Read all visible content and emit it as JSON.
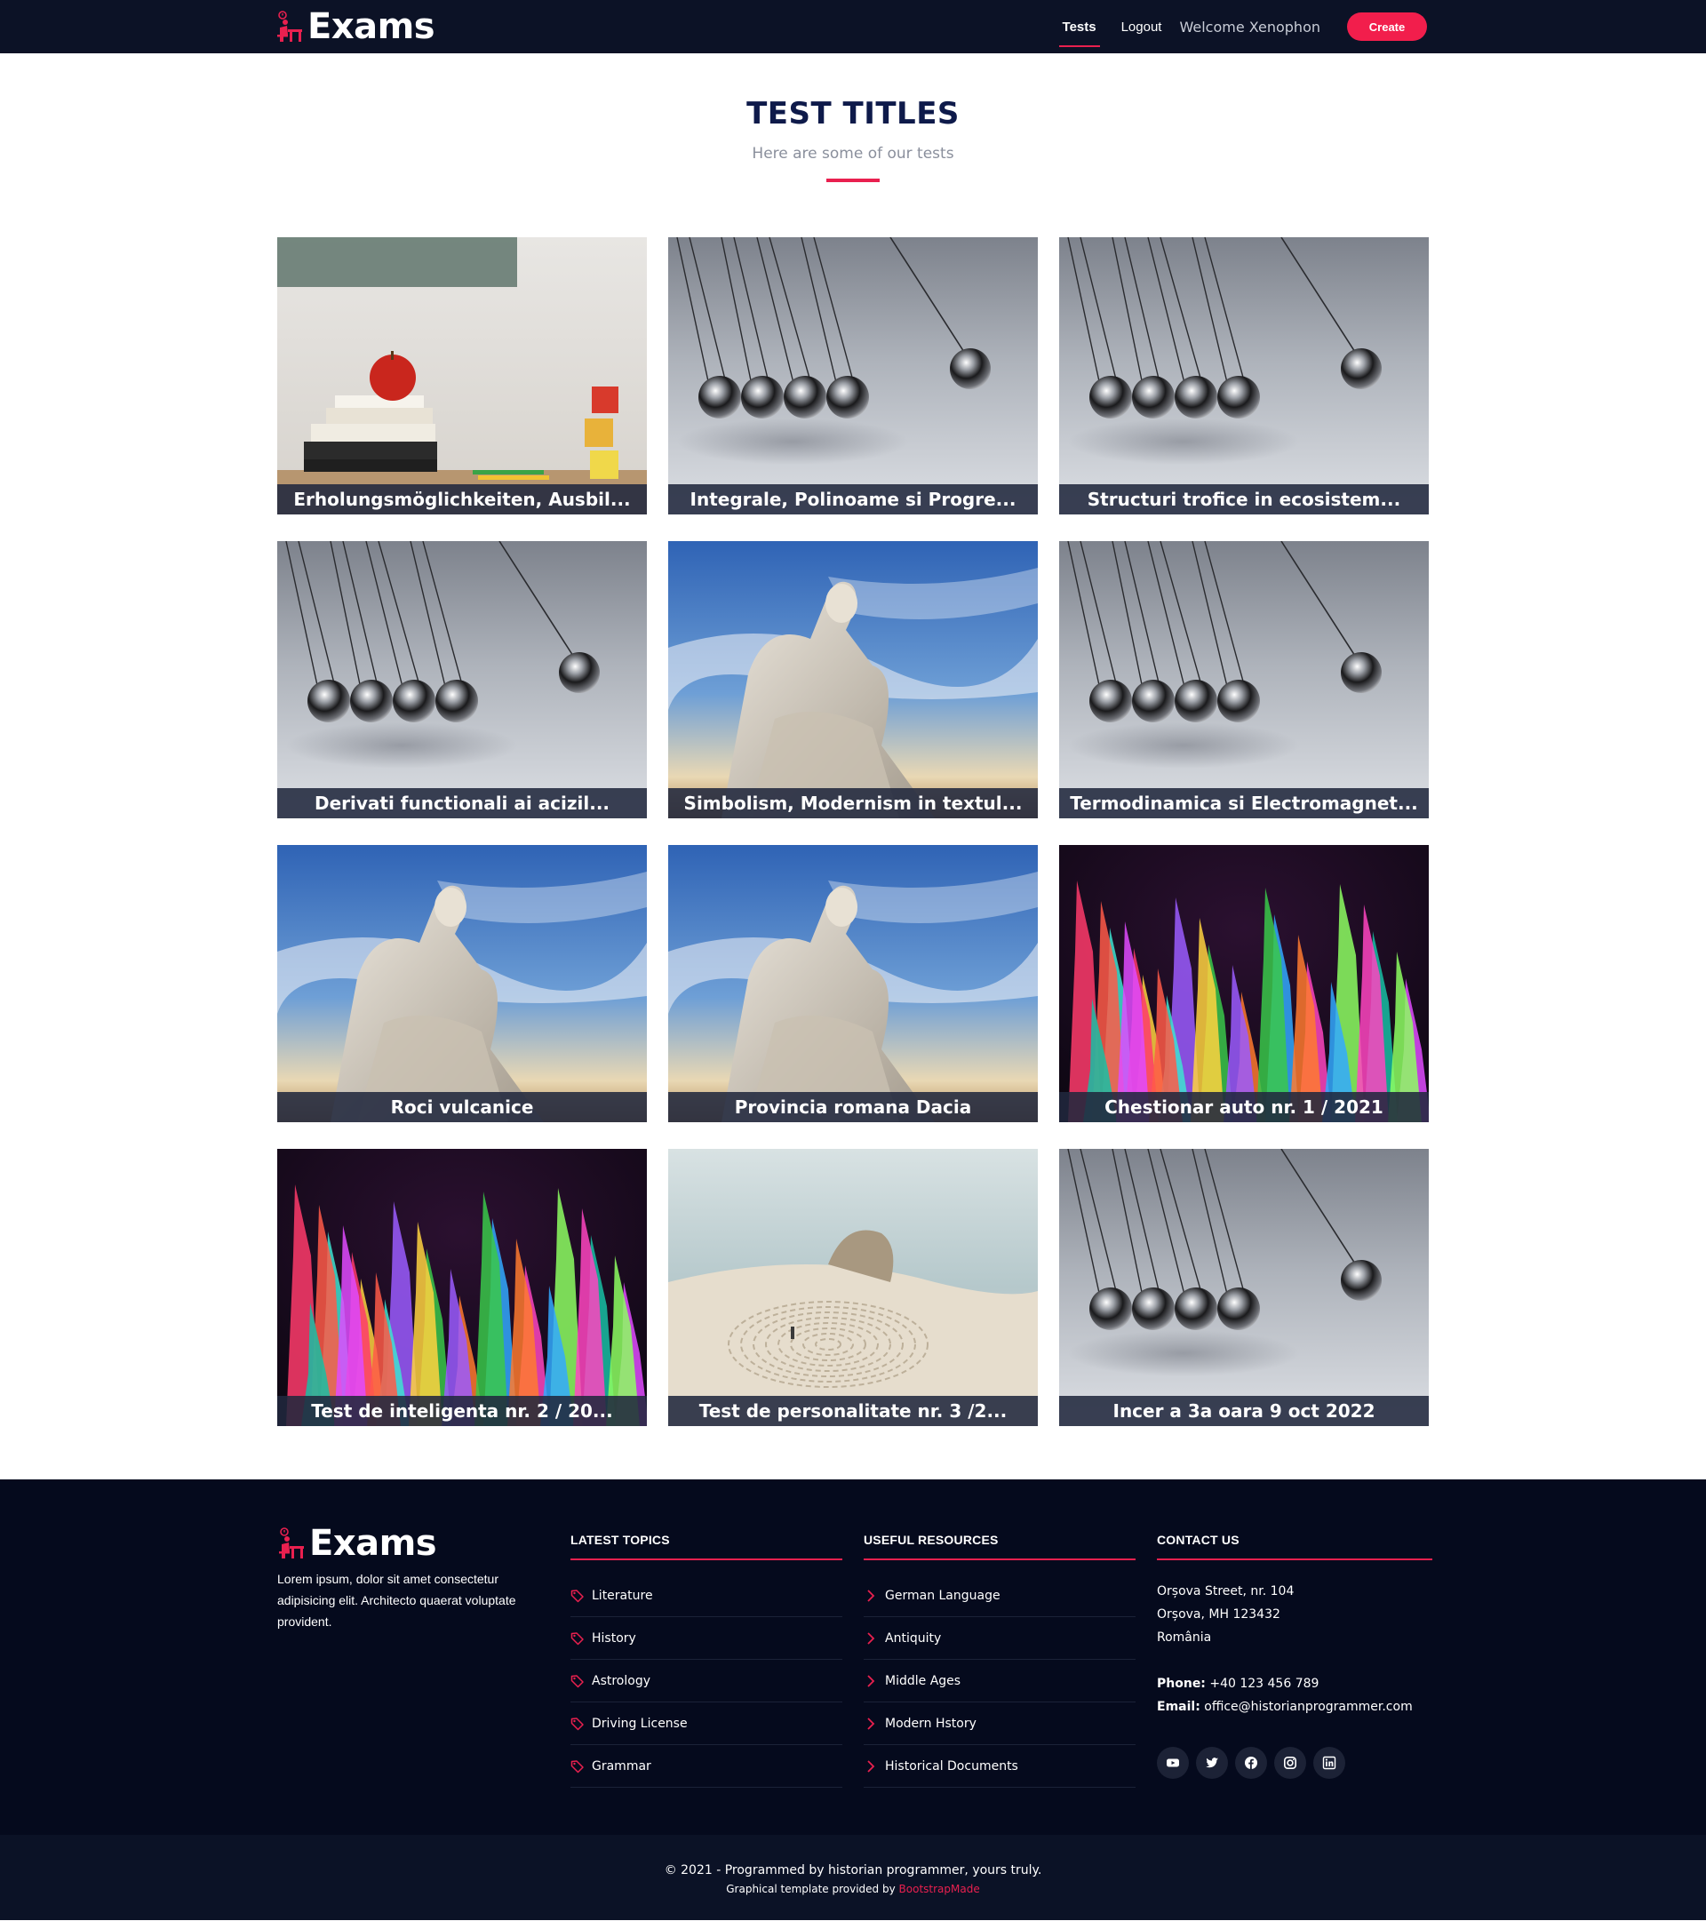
{
  "header": {
    "brand": "Exams",
    "nav": {
      "tests": "Tests",
      "logout": "Logout",
      "welcome": "Welcome Xenophon",
      "create": "Create"
    }
  },
  "section": {
    "title": "TEST TITLES",
    "subtitle": "Here are some of our tests"
  },
  "cards": [
    {
      "title": "Erholungsmöglichkeiten, Ausbil...",
      "image": "apple-books-blocks"
    },
    {
      "title": "Integrale, Polinoame si Progre...",
      "image": "newtons-cradle"
    },
    {
      "title": "Structuri trofice in ecosistem...",
      "image": "newtons-cradle"
    },
    {
      "title": "Derivati functionali ai acizil...",
      "image": "newtons-cradle"
    },
    {
      "title": "Simbolism, Modernism in textul...",
      "image": "socrates-statue"
    },
    {
      "title": "Termodinamica si Electromagnet...",
      "image": "newtons-cradle"
    },
    {
      "title": "Roci vulcanice",
      "image": "socrates-statue"
    },
    {
      "title": "Provincia romana Dacia",
      "image": "socrates-statue"
    },
    {
      "title": "Chestionar auto nr. 1 / 2021",
      "image": "colored-pencils"
    },
    {
      "title": "Test de inteligenta nr. 2 / 20...",
      "image": "colored-pencils"
    },
    {
      "title": "Test de personalitate nr. 3 /2...",
      "image": "beach-labyrinth"
    },
    {
      "title": "Incer a 3a oara 9 oct 2022",
      "image": "newtons-cradle"
    }
  ],
  "footer": {
    "brand": "Exams",
    "about": "Lorem ipsum, dolor sit amet consectetur adipisicing elit. Architecto quaerat voluptate provident.",
    "latest_topics": {
      "heading": "LATEST TOPICS",
      "items": [
        "Literature",
        "History",
        "Astrology",
        "Driving License",
        "Grammar"
      ]
    },
    "useful_resources": {
      "heading": "USEFUL RESOURCES",
      "items": [
        "German Language",
        "Antiquity",
        "Middle Ages",
        "Modern Hstory",
        "Historical Documents"
      ]
    },
    "contact": {
      "heading": "CONTACT US",
      "address1": "Orșova Street, nr. 104",
      "address2": "Orșova, MH 123432",
      "address3": "România",
      "phone_label": "Phone:",
      "phone": "+40 123 456 789",
      "email_label": "Email:",
      "email": "office@historianprogrammer.com"
    },
    "social": [
      "youtube-icon",
      "twitter-icon",
      "facebook-icon",
      "instagram-icon",
      "linkedin-icon"
    ]
  },
  "copyright": {
    "line1": "© 2021 - Programmed by historian programmer, yours truly.",
    "line2_prefix": "Graphical template provided by",
    "line2_link": "BootstrapMade"
  },
  "colors": {
    "accent": "#e9204f",
    "header_bg": "#0c1226",
    "footer_bg": "#050a1d",
    "title": "#0e1a4a"
  }
}
